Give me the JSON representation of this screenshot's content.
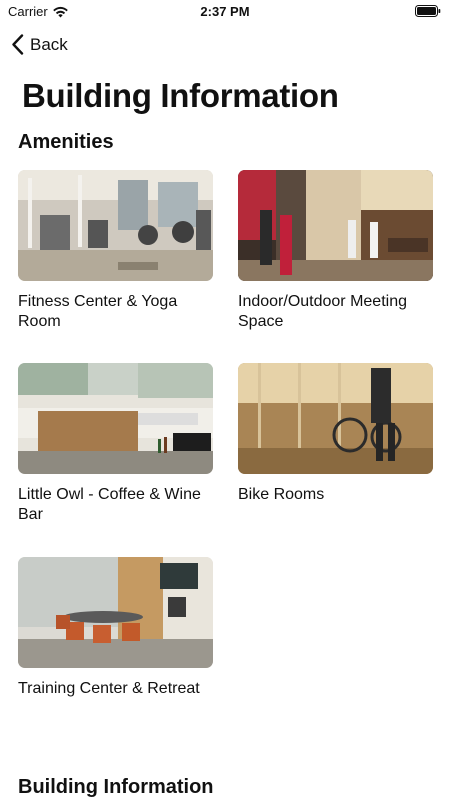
{
  "status_bar": {
    "carrier": "Carrier",
    "time": "2:37 PM"
  },
  "nav": {
    "back_label": "Back"
  },
  "page": {
    "title": "Building Information"
  },
  "sections": {
    "amenities": "Amenities",
    "building_information": "Building Information"
  },
  "amenities": [
    {
      "label": "Fitness Center & Yoga Room",
      "icon": "gym-photo"
    },
    {
      "label": "Indoor/Outdoor Meeting Space",
      "icon": "meeting-space-photo"
    },
    {
      "label": "Little Owl - Coffee & Wine Bar",
      "icon": "coffee-bar-photo"
    },
    {
      "label": "Bike Rooms",
      "icon": "bike-room-photo"
    },
    {
      "label": "Training Center & Retreat",
      "icon": "training-center-photo"
    }
  ]
}
